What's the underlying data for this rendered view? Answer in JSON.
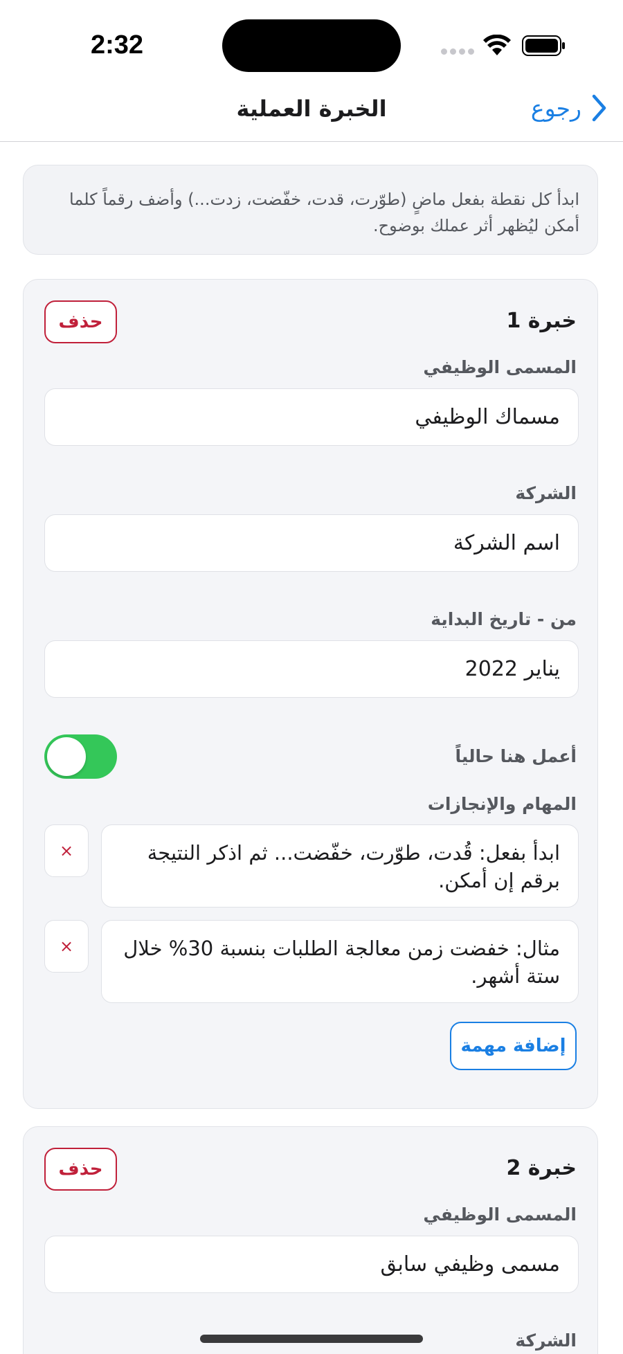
{
  "status_bar": {
    "time": "2:32"
  },
  "nav": {
    "title": "الخبرة العملية",
    "back_label": "رجوع"
  },
  "hint": "ابدأ كل نقطة بفعل ماضٍ (طوّرت، قدت، خفّضت، زدت...) وأضف رقماً كلما أمكن ليُظهر أثر عملك بوضوح.",
  "experiences": [
    {
      "title": "خبرة 1",
      "delete_label": "حذف",
      "job_title_label": "المسمى الوظيفي",
      "job_title_value": "مسماك الوظيفي",
      "company_label": "الشركة",
      "company_value": "اسم الشركة",
      "start_label": "من - تاريخ البداية",
      "start_value": "يناير 2022",
      "current_label": "أعمل هنا حالياً",
      "current_on": true,
      "tasks_label": "المهام والإنجازات",
      "tasks": [
        {
          "text": "ابدأ بفعل: قُدت، طوّرت، خفّضت... ثم اذكر النتيجة برقم إن أمكن.",
          "remove_label": "×"
        },
        {
          "text": "مثال: خفضت زمن معالجة الطلبات بنسبة 30% خلال ستة أشهر.",
          "remove_label": "×"
        }
      ],
      "add_task_label": "إضافة مهمة"
    },
    {
      "title": "خبرة 2",
      "delete_label": "حذف",
      "job_title_label": "المسمى الوظيفي",
      "job_title_value": "مسمى وظيفي سابق",
      "company_label": "الشركة"
    }
  ],
  "colors": {
    "accent": "#1a7fe3",
    "danger": "#c0203a",
    "toggle_on": "#34c759",
    "card_bg": "#f4f5f8"
  }
}
